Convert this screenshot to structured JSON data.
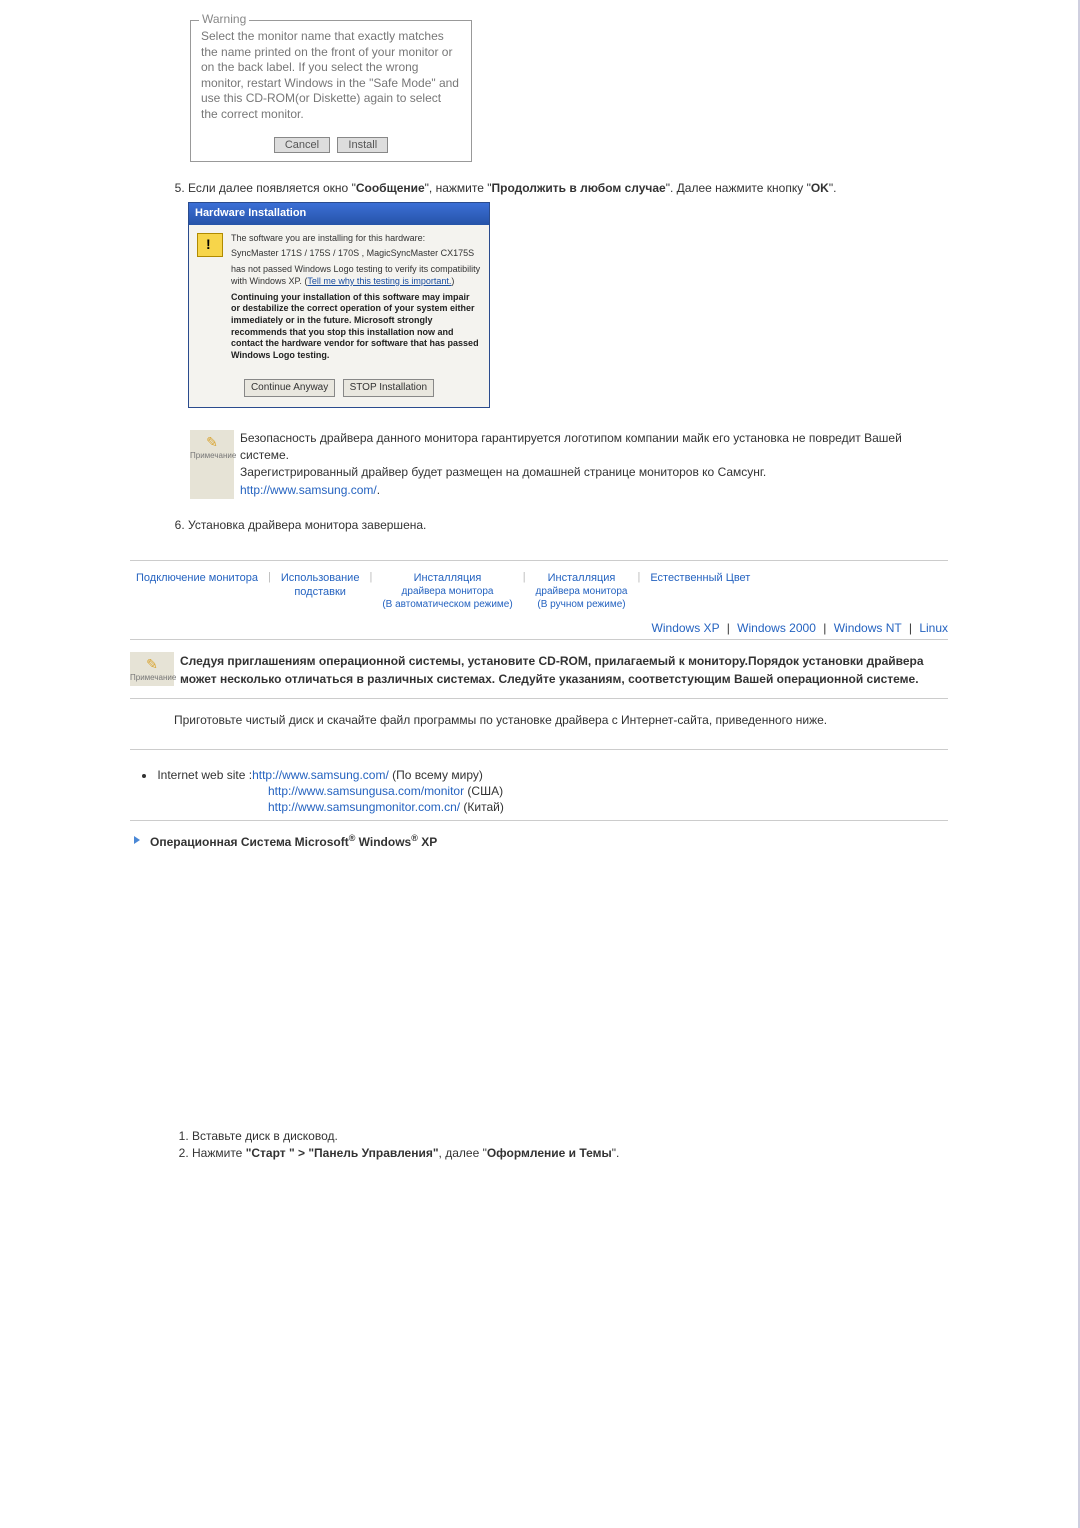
{
  "warning": {
    "legend": "Warning",
    "text": "Select the monitor name that exactly matches the name printed on the front of your monitor or on the back label. If you select the wrong monitor, restart Windows in the \"Safe Mode\" and use this CD-ROM(or Diskette) again to select the correct monitor.",
    "cancel": "Cancel",
    "install": "Install"
  },
  "step5": {
    "prefix": "Если далее появляется окно \"",
    "bold1": "Сообщение",
    "mid": "\", нажмите \"",
    "bold2": "Продолжить в любом случае",
    "after": "\". Далее нажмите кнопку \"",
    "bold3": "OK",
    "end": "\"."
  },
  "hw": {
    "title": "Hardware Installation",
    "r1": "The software you are installing for this hardware:",
    "r2": "SyncMaster 171S / 175S / 170S , MagicSyncMaster CX175S",
    "r3a": "has not passed Windows Logo testing to verify its compatibility with Windows XP. (",
    "r3link": "Tell me why this testing is important.",
    "r3b": ")",
    "r4": "Continuing your installation of this software may impair or destabilize the correct operation of your system either immediately or in the future. Microsoft strongly recommends that you stop this installation now and contact the hardware vendor for software that has passed Windows Logo testing.",
    "btnContinue": "Continue Anyway",
    "btnStop": "STOP Installation"
  },
  "note": {
    "label": "Примечание",
    "l1": "Безопасность драйвера данного монитора гарантируется логотипом компании майк его установка не повредит Вашей системе.",
    "l2": "Зарегистрированный драйвер будет размещен на домашней странице мониторов ко Самсунг.",
    "link": "http://www.samsung.com/",
    "dot": "."
  },
  "step6": "Установка драйвера монитора завершена.",
  "tabs": {
    "t1": "Подключение монитора",
    "t2a": "Использование",
    "t2b": "подставки",
    "t3a": "Инсталляция",
    "t3b": "драйвера монитора",
    "t3c": "(В автоматическом режиме)",
    "t4a": "Инсталляция",
    "t4b": "драйвера монитора",
    "t4c": "(В ручном режиме)",
    "t5": "Естественный Цвет"
  },
  "os": {
    "xp": "Windows XP",
    "w2k": "Windows 2000",
    "nt": "Windows NT",
    "linux": "Linux"
  },
  "note2": {
    "text": "Следуя приглашениям операционной системы, установите CD-ROM, прилагаемый к монитору.Порядок установки драйвера может несколько отличаться в различных системах. Следуйте указаниям, соответстующим Вашей операционной системе."
  },
  "para": "Приготовьте чистый диск и скачайте файл программы по установке драйвера с Интернет-сайта, приведенного ниже.",
  "web": {
    "lead": "Internet web site :",
    "u1": "http://www.samsung.com/",
    "s1": " (По всему миру)",
    "u2": "http://www.samsungusa.com/monitor",
    "s2": " (США)",
    "u3": "http://www.samsungmonitor.com.cn/",
    "s3": " (Китай)"
  },
  "heading": {
    "pre": "Операционная Система Microsoft",
    "mid": " Windows",
    "suf": " XP",
    "reg": "®"
  },
  "bottom": {
    "i1": "Вставьте диск в дисковод.",
    "i2a": "Нажмите ",
    "i2b": "\"Старт \" > \"Панель Управления\"",
    "i2c": ", далее \"",
    "i2d": "Оформление и Темы",
    "i2e": "\"."
  }
}
